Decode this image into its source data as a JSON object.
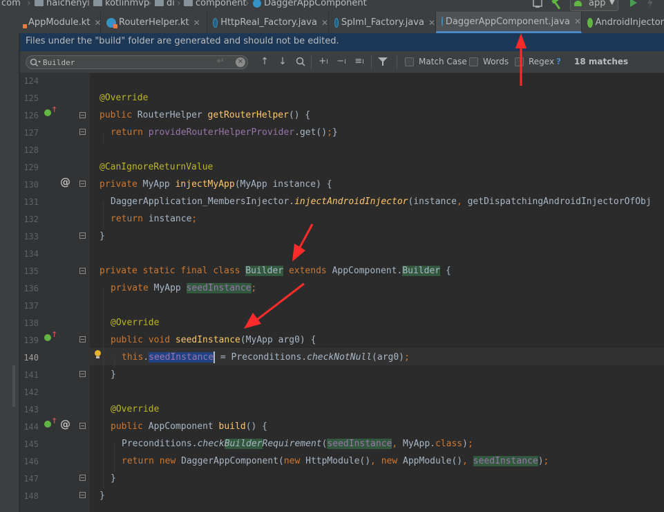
{
  "breadcrumb": [
    "com",
    "haichenyi",
    "kotlinmvp",
    "di",
    "component",
    "DaggerAppComponent"
  ],
  "toolbar": {
    "run_config": "app"
  },
  "tabs": [
    {
      "label": "AppModule.kt",
      "type": "kt"
    },
    {
      "label": "RouterHelper.kt",
      "type": "kt"
    },
    {
      "label": "HttpReal_Factory.java",
      "type": "java"
    },
    {
      "label": "SpIml_Factory.java",
      "type": "java"
    },
    {
      "label": "DaggerAppComponent.java",
      "type": "java",
      "active": true
    },
    {
      "label": "AndroidInjector",
      "type": "android"
    }
  ],
  "banner": "Files under the \"build\" folder are generated and should not be edited.",
  "search": {
    "query": "Builder",
    "match_case_label": "Match Case",
    "words_label": "Words",
    "regex_label": "Regex",
    "help_label": "?",
    "matches": "18 matches"
  },
  "line_numbers": [
    "124",
    "125",
    "126",
    "127",
    "128",
    "129",
    "130",
    "131",
    "132",
    "133",
    "134",
    "135",
    "136",
    "137",
    "138",
    "139",
    "140",
    "141",
    "142",
    "143",
    "144",
    "145",
    "146",
    "147",
    "148"
  ],
  "current_line": "140",
  "colors": {
    "accent_tab": "#4a88c7",
    "banner_bg": "#1d3857",
    "keyword": "#cc7832",
    "annotation": "#bbb529",
    "method": "#ffc66d",
    "field": "#9876aa",
    "arrow": "#ff2b2b"
  },
  "code": {
    "l125": "@Override",
    "l126_a": "public ",
    "l126_b": "RouterHelper ",
    "l126_c": "getRouterHelper",
    "l126_d": "() {",
    "l127_a": "return ",
    "l127_b": "provideRouterHelperProvider",
    "l127_c": ".get()",
    "l127_d": ";",
    "l127_e": "}",
    "l129": "@CanIgnoreReturnValue",
    "l130_a": "private ",
    "l130_b": "MyApp ",
    "l130_c": "injectMyApp",
    "l130_d": "(MyApp instance) {",
    "l131_a": "DaggerApplication_MembersInjector.",
    "l131_b": "injectAndroidInjector",
    "l131_c": "(instance",
    "l131_d": ", ",
    "l131_e": "getDispatchingAndroidInjectorOfObj",
    "l132_a": "return ",
    "l132_b": "instance",
    "l132_c": ";",
    "l133": "}",
    "l135_a": "private static final class ",
    "l135_b": "Builder",
    "l135_c": " extends ",
    "l135_d": "AppComponent.",
    "l135_e": "Builder",
    "l135_f": " {",
    "l136_a": "private ",
    "l136_b": "MyApp ",
    "l136_c": "seedInstance",
    "l136_d": ";",
    "l138": "@Override",
    "l139_a": "public void ",
    "l139_b": "seedInstance",
    "l139_c": "(MyApp arg0) {",
    "l140_a": "this",
    "l140_b": ".",
    "l140_c": "seedInstance",
    "l140_d": " = Preconditions.",
    "l140_e": "checkNotNull",
    "l140_f": "(arg0)",
    "l140_g": ";",
    "l141": "}",
    "l143": "@Override",
    "l144_a": "public ",
    "l144_b": "AppComponent ",
    "l144_c": "build",
    "l144_d": "() {",
    "l145_a": "Preconditions.",
    "l145_b": "check",
    "l145_c": "Builder",
    "l145_d": "Requirement",
    "l145_e": "(",
    "l145_f": "seedInstance",
    "l145_g": ", ",
    "l145_h": "MyApp.",
    "l145_i": "class",
    "l145_j": ")",
    "l145_k": ";",
    "l146_a": "return new ",
    "l146_b": "DaggerAppComponent(",
    "l146_c": "new ",
    "l146_d": "HttpModule()",
    "l146_e": ", ",
    "l146_f": "new ",
    "l146_g": "AppModule()",
    "l146_h": ", ",
    "l146_i": "seedInstance",
    "l146_j": ")",
    "l146_k": ";",
    "l147": "}",
    "l148": "}"
  }
}
